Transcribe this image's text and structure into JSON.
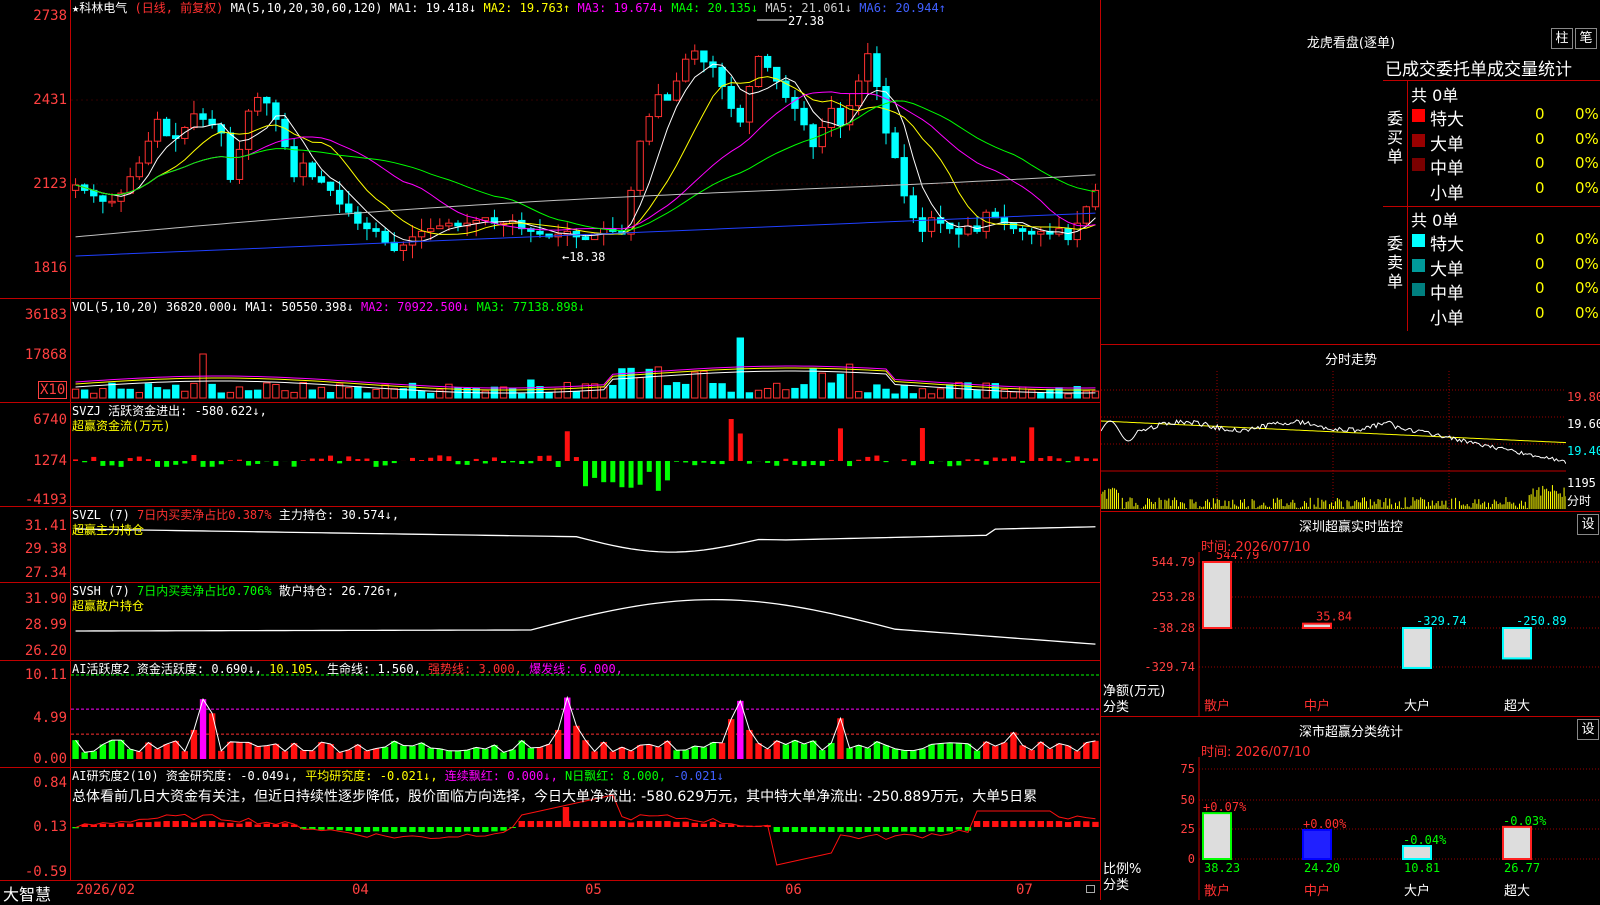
{
  "header": {
    "stock_name": "★科林电气",
    "mode": "(日线, 前复权)",
    "ma_label": "MA(5,10,20,30,60,120)",
    "ma1": "MA1: 19.418↓",
    "ma2": "MA2: 19.763↑",
    "ma3": "MA3: 19.674↓",
    "ma4": "MA4: 20.135↓",
    "ma5": "MA5: 21.061↓",
    "ma6": "MA6: 20.944↑",
    "high_mark": "27.38",
    "low_mark": "←18.38"
  },
  "kline_axis": [
    "2738",
    "2431",
    "2123",
    "1816"
  ],
  "vol": {
    "title": "VOL(5,10,20) 36820.000↓",
    "ma1": "MA1: 50550.398↓",
    "ma2": "MA2: 70922.500↓",
    "ma3": "MA3: 77138.898↓",
    "axis": [
      "36183",
      "17868"
    ],
    "unit": "X10"
  },
  "svzj": {
    "title": "SVZJ  活跃资金进出: -580.622↓,",
    "sub": "超赢资金流(万元)",
    "axis": [
      "6740",
      "1274",
      "-4193"
    ]
  },
  "svzl": {
    "name": "SVZL (7)",
    "desc": "7日内买卖净占比0.387%",
    "value": "主力持仓: 30.574↓,",
    "sub": "超赢主力持仓",
    "axis": [
      "31.41",
      "29.38",
      "27.34"
    ]
  },
  "svsh": {
    "name": "SVSH (7)",
    "desc": "7日内买卖净占比0.706%",
    "value": "散户持仓: 26.726↑,",
    "sub": "超赢散户持仓",
    "axis": [
      "31.90",
      "28.99",
      "26.20"
    ]
  },
  "ai1": {
    "name": "AI活跃度2",
    "v1": "资金活跃度: 0.690↓,",
    "v2": "10.105,",
    "v3": "生命线: 1.560,",
    "v4": "强势线: 3.000,",
    "v5": "爆发线: 6.000,",
    "axis": [
      "10.11",
      "4.99",
      "0.00"
    ]
  },
  "ai2": {
    "name": "AI研究度2(10)",
    "v1": "资金研究度: -0.049↓,",
    "v2": "平均研究度: -0.021↓,",
    "v3": "连续飘红: 0.000↓,",
    "v4": "N日飘红: 8.000,",
    "v5": "-0.021↓",
    "comment": "总体看前几日大资金有关注，但近日持续性逐步降低，股价面临方向选择，今日大单净流出: -580.629万元，其中特大单净流出: -250.889万元，大单5日累",
    "axis": [
      "0.84",
      "0.13",
      "-0.59"
    ]
  },
  "bottom": {
    "logo": "大智慧",
    "dates": [
      "2026/02",
      "04",
      "05",
      "06",
      "07"
    ]
  },
  "dragon": {
    "title": "龙虎看盘(逐单)",
    "btn1": "柱",
    "btn2": "笔",
    "head": "已成交委托单成交量统计",
    "buy_label": "委买单",
    "sell_label": "委卖单",
    "buy_total": "共 0单",
    "sell_total": "共 0单",
    "buy_rows": [
      {
        "name": "特大",
        "count": "0",
        "pct": "0%"
      },
      {
        "name": "大单",
        "count": "0",
        "pct": "0%"
      },
      {
        "name": "中单",
        "count": "0",
        "pct": "0%"
      },
      {
        "name": "小单",
        "count": "0",
        "pct": "0%"
      }
    ],
    "sell_rows": [
      {
        "name": "特大",
        "count": "0",
        "pct": "0%"
      },
      {
        "name": "大单",
        "count": "0",
        "pct": "0%"
      },
      {
        "name": "中单",
        "count": "0",
        "pct": "0%"
      },
      {
        "name": "小单",
        "count": "0",
        "pct": "0%"
      }
    ],
    "buy_colors": [
      "#ff0000",
      "#9a0000",
      "#7a0000",
      "#000000"
    ],
    "sell_colors": [
      "#00ffff",
      "#009a9a",
      "#008080",
      "#000000"
    ]
  },
  "intraday": {
    "title": "分时走势",
    "axis": [
      "19.80",
      "19.60",
      "19.40"
    ],
    "vol_label": "1195",
    "time_label": "分时"
  },
  "sz_monitor": {
    "title": "深圳超赢实时监控",
    "set": "设",
    "time": "时间: 2026/07/10",
    "axis": [
      "544.79",
      "253.28",
      "-38.28",
      "-329.74"
    ],
    "unit": "净额(万元)",
    "cat_label": "分类",
    "bars": [
      {
        "cat": "散户",
        "value": "544.79"
      },
      {
        "cat": "中户",
        "value": "35.84"
      },
      {
        "cat": "大户",
        "value": "-329.74"
      },
      {
        "cat": "超大",
        "value": "-250.89"
      }
    ]
  },
  "sz_class": {
    "title": "深市超赢分类统计",
    "set": "设",
    "time": "时间: 2026/07/10",
    "axis": [
      "75",
      "50",
      "25",
      "0"
    ],
    "unit": "比例%",
    "cat_label": "分类",
    "bars": [
      {
        "cat": "散户",
        "top": "+0.07%",
        "bottom": "38.23"
      },
      {
        "cat": "中户",
        "top": "+0.00%",
        "bottom": "24.20"
      },
      {
        "cat": "大户",
        "top": "-0.04%",
        "bottom": "10.81"
      },
      {
        "cat": "超大",
        "top": "-0.03%",
        "bottom": "26.77"
      }
    ]
  },
  "colors": {
    "up": "#ff3030",
    "down": "#00ffff",
    "grid": "#c00000",
    "yellow": "#ffff00",
    "magenta": "#ff00ff",
    "green": "#00ff00"
  }
}
